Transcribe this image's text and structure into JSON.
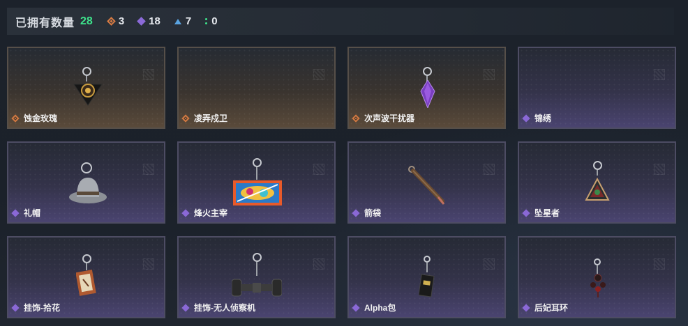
{
  "header": {
    "title": "已拥有数量",
    "total": "28",
    "stats": [
      {
        "icon": "orange-gem-icon",
        "value": "3"
      },
      {
        "icon": "purple-gem-icon",
        "value": "18"
      },
      {
        "icon": "blue-triangle-icon",
        "value": "7"
      },
      {
        "icon": "green-dots-icon",
        "value": "0"
      }
    ]
  },
  "colors": {
    "total": "#3ee48c",
    "orange_rarity": "#d77b43",
    "purple_rarity": "#8b6ad8",
    "blue_rarity": "#5aa3e0",
    "green_rarity": "#3ee48c"
  },
  "items": [
    {
      "name": "蚀金玫瑰",
      "rarity": "orange",
      "icon": "rose-pendant-icon"
    },
    {
      "name": "凌弄戍卫",
      "rarity": "orange",
      "icon": ""
    },
    {
      "name": "次声波干扰器",
      "rarity": "orange",
      "icon": "purple-crystal-icon"
    },
    {
      "name": "锦绣",
      "rarity": "purple",
      "icon": ""
    },
    {
      "name": "礼帽",
      "rarity": "purple",
      "icon": "top-hat-icon"
    },
    {
      "name": "烽火主宰",
      "rarity": "purple",
      "icon": "graffiti-banner-icon"
    },
    {
      "name": "箭袋",
      "rarity": "purple",
      "icon": "quiver-icon"
    },
    {
      "name": "坠星者",
      "rarity": "purple",
      "icon": "triangle-badge-icon"
    },
    {
      "name": "挂饰-拾花",
      "rarity": "purple",
      "icon": "picture-frame-icon"
    },
    {
      "name": "挂饰-无人侦察机",
      "rarity": "purple",
      "icon": "drone-icon"
    },
    {
      "name": "Alpha包",
      "rarity": "purple",
      "icon": "alpha-bag-icon"
    },
    {
      "name": "后妃耳环",
      "rarity": "purple",
      "icon": "earring-icon"
    }
  ]
}
